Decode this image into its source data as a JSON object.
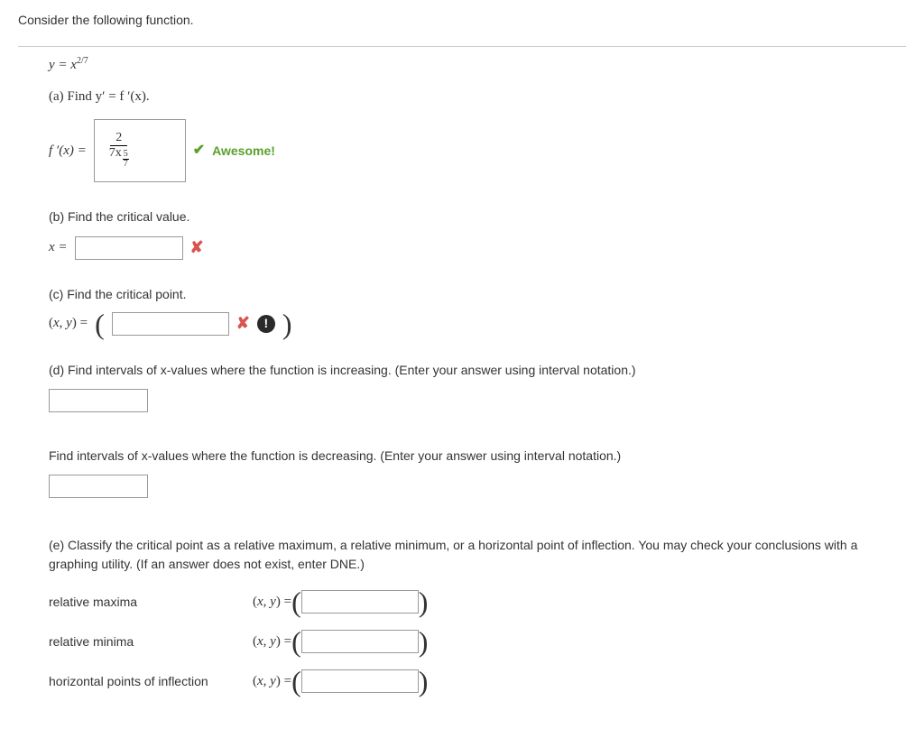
{
  "intro": "Consider the following function.",
  "function": {
    "lhs": "y = x",
    "exp": "2/7"
  },
  "partA": {
    "prompt": "(a) Find y′ = f ′(x).",
    "lhs": "f ′(x) =",
    "answer": {
      "num": "2",
      "den_coeff": "7x",
      "den_exp_num": "5",
      "den_exp_den": "7"
    },
    "feedback": "Awesome!"
  },
  "partB": {
    "prompt": "(b) Find the critical value.",
    "lhs": "x ="
  },
  "partC": {
    "prompt": "(c) Find the critical point.",
    "lhs": "(x, y) ="
  },
  "partD": {
    "prompt_inc": "(d) Find intervals of x-values where the function is increasing. (Enter your answer using interval notation.)",
    "prompt_dec": "Find intervals of x-values where the function is decreasing. (Enter your answer using interval notation.)"
  },
  "partE": {
    "prompt": "(e) Classify the critical point as a relative maximum, a relative minimum, or a horizontal point of inflection. You may check your conclusions with a graphing utility. (If an answer does not exist, enter DNE.)",
    "rows": {
      "max": {
        "label": "relative maxima",
        "lhs": "(x, y) ="
      },
      "min": {
        "label": "relative minima",
        "lhs": "(x, y) ="
      },
      "inf": {
        "label": "horizontal points of inflection",
        "lhs": "(x, y) ="
      }
    }
  }
}
